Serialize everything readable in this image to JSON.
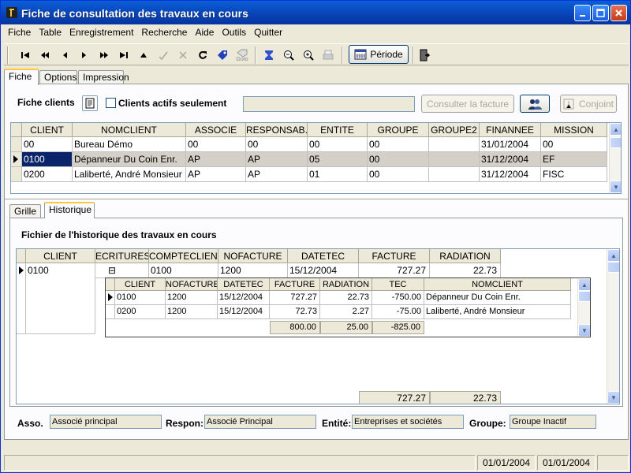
{
  "window": {
    "title": "Fiche de consultation des travaux en cours"
  },
  "menu": [
    "Fiche",
    "Table",
    "Enregistrement",
    "Recherche",
    "Aide",
    "Outils",
    "Quitter"
  ],
  "toolbar": {
    "periode": "Période",
    "goto": "Goto"
  },
  "tabs": [
    "Fiche",
    "Options",
    "Impression"
  ],
  "fiche": {
    "title": "Fiche clients",
    "actifs_label": "Clients actifs seulement",
    "consulter": "Consulter la facture",
    "conjoint": "Conjoint"
  },
  "main_grid": {
    "columns": [
      "CLIENT",
      "NOMCLIENT",
      "ASSOCIE",
      "RESPONSAB...",
      "ENTITE",
      "GROUPE",
      "GROUPE2",
      "FINANNEE",
      "MISSION"
    ],
    "rows": [
      [
        "00",
        "Bureau Démo",
        "00",
        "00",
        "00",
        "00",
        "",
        "31/01/2004",
        "00"
      ],
      [
        "0100",
        "Dépanneur Du Coin Enr.",
        "AP",
        "AP",
        "05",
        "00",
        "",
        "31/12/2004",
        "EF"
      ],
      [
        "0200",
        "Laliberté, André Monsieur",
        "AP",
        "AP",
        "01",
        "00",
        "",
        "31/12/2004",
        "FISC"
      ]
    ]
  },
  "subtabs": [
    "Grille",
    "Historique"
  ],
  "historique": {
    "title": "Fichier de l'historique des travaux en cours",
    "columns": [
      "CLIENT",
      "ECRITURES",
      "COMPTECLIENT",
      "NOFACTURE",
      "DATETEC",
      "FACTURE",
      "RADIATION"
    ],
    "row": {
      "client": "0100",
      "expand": "⊟",
      "compteclient": "0100",
      "nofacture": "1200",
      "datetec": "15/12/2004",
      "facture": "727.27",
      "radiation": "22.73"
    },
    "detail_columns": [
      "CLIENT",
      "NOFACTURE",
      "DATETEC",
      "FACTURE",
      "RADIATION",
      "TEC",
      "NOMCLIENT"
    ],
    "detail_rows": [
      [
        "0100",
        "1200",
        "15/12/2004",
        "727.27",
        "22.73",
        "-750.00",
        "Dépanneur Du Coin Enr."
      ],
      [
        "0200",
        "1200",
        "15/12/2004",
        "72.73",
        "2.27",
        "-75.00",
        "Laliberté, André Monsieur"
      ]
    ],
    "detail_totals": {
      "facture": "800.00",
      "radiation": "25.00",
      "tec": "-825.00"
    },
    "totals": {
      "facture": "727.27",
      "radiation": "22.73"
    }
  },
  "bottom": {
    "asso_label": "Asso.",
    "asso_value": "Associé principal",
    "respon_label": "Respon:",
    "respon_value": "Associé Principal",
    "entite_label": "Entité:",
    "entite_value": "Entreprises et sociétés",
    "groupe_label": "Groupe:",
    "groupe_value": "Groupe Inactif"
  },
  "status": {
    "date1": "01/01/2004",
    "date2": "01/01/2004"
  }
}
